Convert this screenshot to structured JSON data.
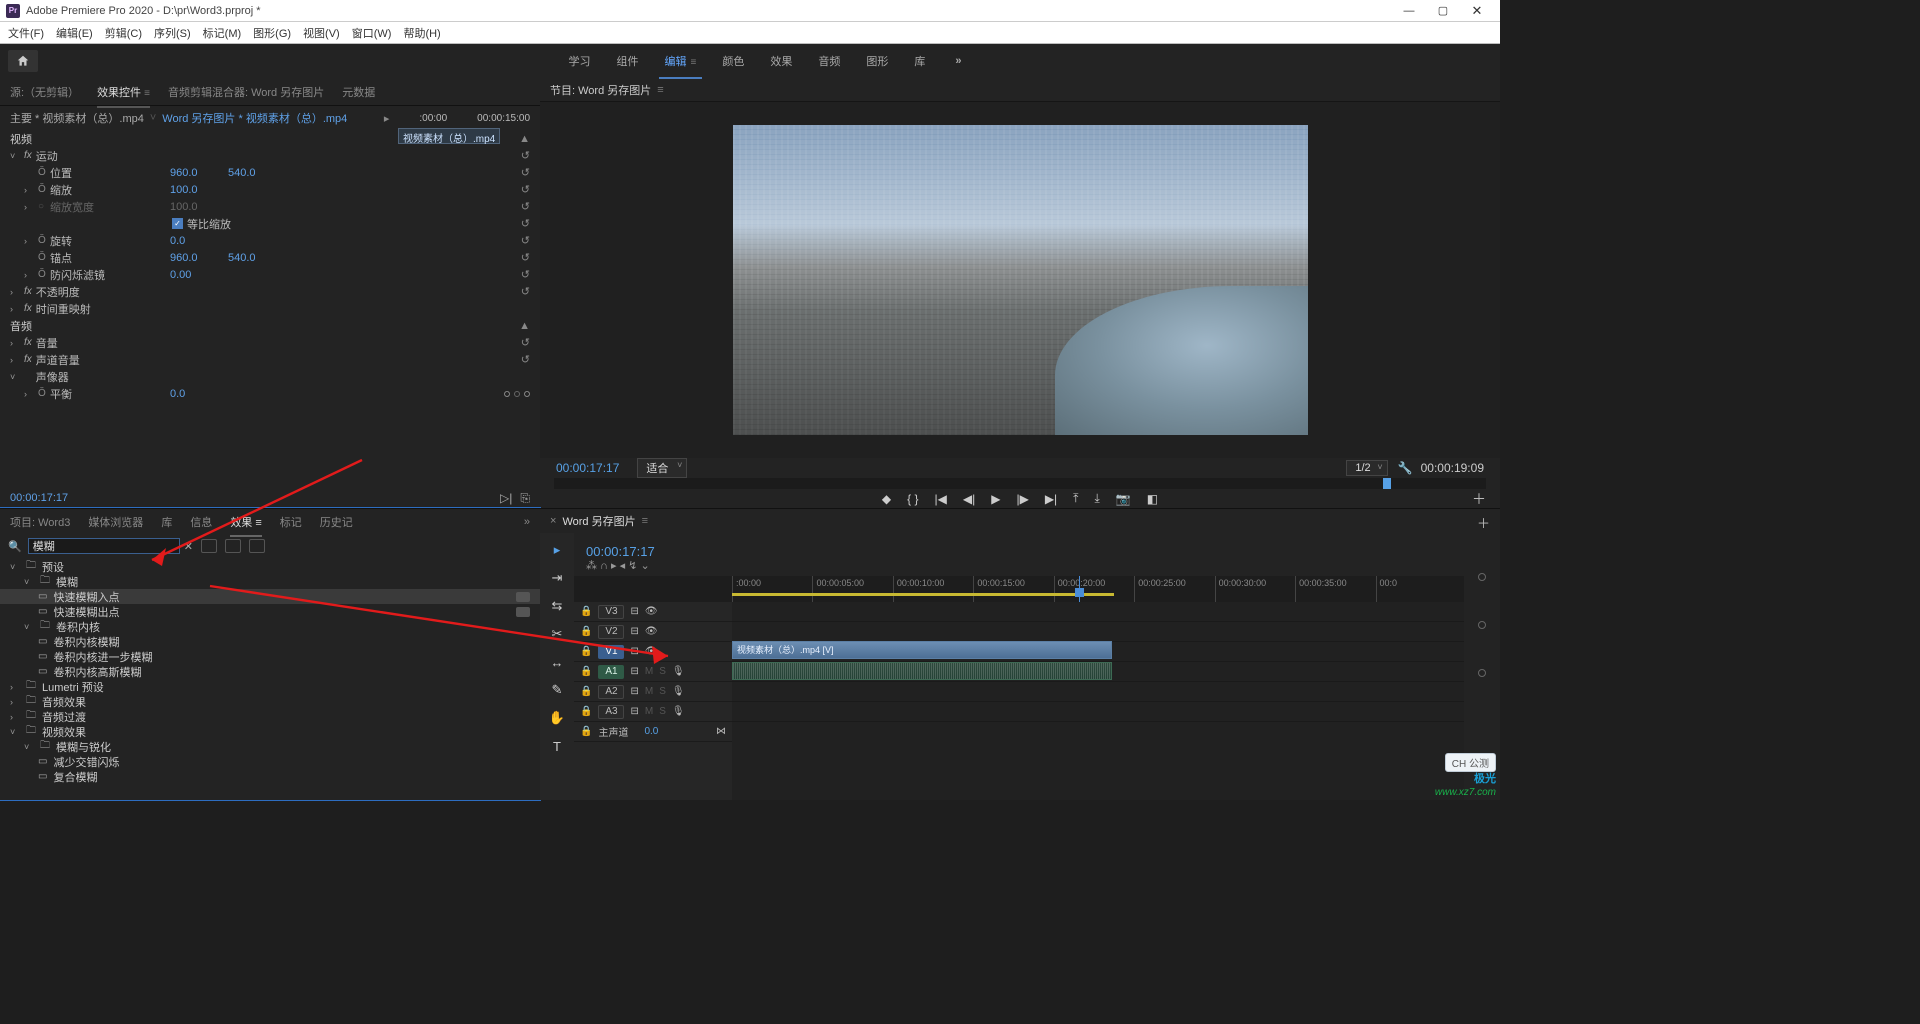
{
  "app": {
    "title": "Adobe Premiere Pro 2020 - D:\\pr\\Word3.prproj *",
    "logo_text": "Pr"
  },
  "menu": [
    "文件(F)",
    "编辑(E)",
    "剪辑(C)",
    "序列(S)",
    "标记(M)",
    "图形(G)",
    "视图(V)",
    "窗口(W)",
    "帮助(H)"
  ],
  "workspaces": [
    "学习",
    "组件",
    "编辑",
    "颜色",
    "效果",
    "音频",
    "图形",
    "库"
  ],
  "workspaces_active": "编辑",
  "source_panel": {
    "tabs": [
      "源:（无剪辑）",
      "效果控件",
      "音频剪辑混合器: Word 另存图片",
      "元数据"
    ],
    "active": "效果控件",
    "breadcrumb_master": "主要 * 视频素材（总）.mp4",
    "breadcrumb_seq": "Word 另存图片 * 视频素材（总）.mp4",
    "timeline_start": ":00:00",
    "timeline_end": "00:00:15:00",
    "strip_name": "视频素材（总）.mp4",
    "sections": {
      "video": "视频",
      "motion": "运动",
      "position": {
        "label": "位置",
        "x": "960.0",
        "y": "540.0"
      },
      "scale": {
        "label": "缩放",
        "v": "100.0"
      },
      "scale_w": {
        "label": "缩放宽度",
        "v": "100.0"
      },
      "uniform": {
        "label": "等比缩放"
      },
      "rotation": {
        "label": "旋转",
        "v": "0.0"
      },
      "anchor": {
        "label": "锚点",
        "x": "960.0",
        "y": "540.0"
      },
      "deflicker": {
        "label": "防闪烁滤镜",
        "v": "0.00"
      },
      "opacity": "不透明度",
      "timeremap": "时间重映射",
      "audio": "音频",
      "volume": "音量",
      "channel_vol": "声道音量",
      "panner": "声像器",
      "balance": {
        "label": "平衡",
        "v": "0.0"
      }
    },
    "foot_tc": "00:00:17:17"
  },
  "program": {
    "title": "节目: Word 另存图片",
    "tc": "00:00:17:17",
    "fit": "适合",
    "zoom": "1/2",
    "duration": "00:00:19:09"
  },
  "project_panel": {
    "tabs": [
      "项目: Word3",
      "媒体浏览器",
      "库",
      "信息",
      "效果",
      "标记",
      "历史记"
    ],
    "active": "效果",
    "search_value": "模糊",
    "tree": [
      {
        "t": "folder",
        "open": true,
        "lbl": "预设"
      },
      {
        "t": "folder",
        "open": true,
        "lbl": "模糊",
        "indent": 1
      },
      {
        "t": "leaf",
        "lbl": "快速模糊入点",
        "sel": true,
        "indent": 2,
        "badge": true
      },
      {
        "t": "leaf",
        "lbl": "快速模糊出点",
        "indent": 2,
        "badge": true
      },
      {
        "t": "folder",
        "open": true,
        "lbl": "卷积内核",
        "indent": 1
      },
      {
        "t": "leaf",
        "lbl": "卷积内核模糊",
        "indent": 2
      },
      {
        "t": "leaf",
        "lbl": "卷积内核进一步模糊",
        "indent": 2
      },
      {
        "t": "leaf",
        "lbl": "卷积内核高斯模糊",
        "indent": 2
      },
      {
        "t": "folder",
        "open": false,
        "lbl": "Lumetri 预设"
      },
      {
        "t": "folder",
        "open": false,
        "lbl": "音频效果"
      },
      {
        "t": "folder",
        "open": false,
        "lbl": "音频过渡"
      },
      {
        "t": "folder",
        "open": true,
        "lbl": "视频效果"
      },
      {
        "t": "folder",
        "open": true,
        "lbl": "模糊与锐化",
        "indent": 1
      },
      {
        "t": "leaf",
        "lbl": "减少交错闪烁",
        "indent": 2
      },
      {
        "t": "leaf",
        "lbl": "复合模糊",
        "indent": 2
      }
    ]
  },
  "timeline": {
    "seq_name": "Word 另存图片",
    "tc": "00:00:17:17",
    "ruler": [
      ":00:00",
      "00:00:05:00",
      "00:00:10:00",
      "00:00:15:00",
      "00:00:20:00",
      "00:00:25:00",
      "00:00:30:00",
      "00:00:35:00",
      "00:0"
    ],
    "tracks_v": [
      "V3",
      "V2",
      "V1"
    ],
    "tracks_a": [
      "A1",
      "A2",
      "A3"
    ],
    "master": "主声道",
    "master_val": "0.0",
    "clip_v": "视频素材（总）.mp4 [V]",
    "tools": [
      "select",
      "track-select",
      "ripple",
      "razor",
      "slip",
      "pen",
      "hand",
      "type"
    ]
  },
  "watermark": {
    "badge": "CH 公测",
    "brand": "极光",
    "url": "www.xz7.com"
  }
}
